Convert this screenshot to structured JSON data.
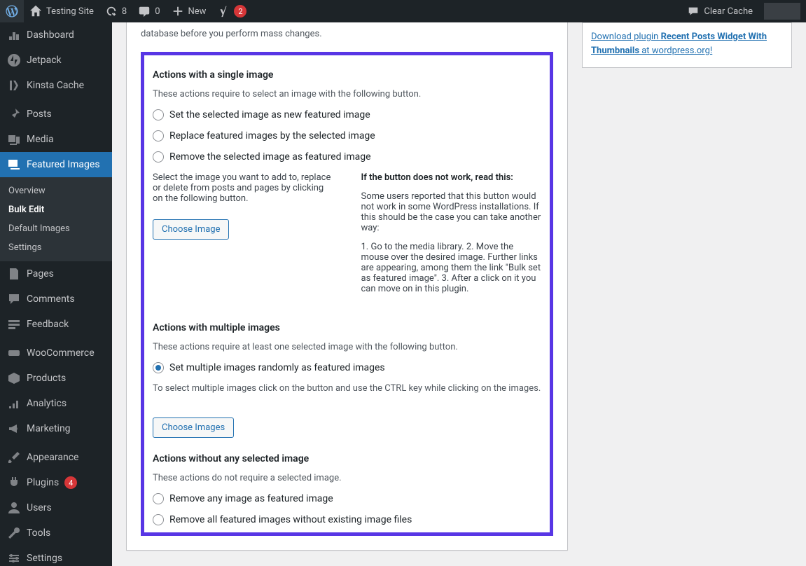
{
  "adminbar": {
    "site_name": "Testing Site",
    "updates_count": "8",
    "comments_count": "0",
    "new_label": "New",
    "yoast_count": "2",
    "clear_cache": "Clear Cache"
  },
  "sidebar": {
    "dashboard": "Dashboard",
    "jetpack": "Jetpack",
    "kinsta": "Kinsta Cache",
    "posts": "Posts",
    "media": "Media",
    "featured_images": "Featured Images",
    "sub": {
      "overview": "Overview",
      "bulk_edit": "Bulk Edit",
      "default_images": "Default Images",
      "settings": "Settings"
    },
    "pages": "Pages",
    "comments": "Comments",
    "feedback": "Feedback",
    "woocommerce": "WooCommerce",
    "products": "Products",
    "analytics": "Analytics",
    "marketing": "Marketing",
    "appearance": "Appearance",
    "plugins": "Plugins",
    "plugins_count": "4",
    "users": "Users",
    "tools": "Tools",
    "settings": "Settings"
  },
  "main": {
    "pre_text": "database before you perform mass changes.",
    "single": {
      "heading": "Actions with a single image",
      "desc": "These actions require to select an image with the following button.",
      "options": {
        "set": "Set the selected image as new featured image",
        "replace": "Replace featured images by the selected image",
        "remove": "Remove the selected image as featured image"
      },
      "left_help": "Select the image you want to add to, replace or delete from posts and pages by clicking on the following button.",
      "choose_btn": "Choose Image",
      "right_head": "If the button does not work, read this:",
      "right_p1": "Some users reported that this button would not work in some WordPress installations. If this should be the case you can take another way:",
      "right_p2": "1. Go to the media library. 2. Move the mouse over the desired image. Further links are appearing, among them the link \"Bulk set as featured image\". 3. After a click on it you can move on in this plugin."
    },
    "multiple": {
      "heading": "Actions with multiple images",
      "desc": "These actions require at least one selected image with the following button.",
      "option": "Set multiple images randomly as featured images",
      "help": "To select multiple images click on the button and use the CTRL key while clicking on the images.",
      "choose_btn": "Choose Images"
    },
    "none": {
      "heading": "Actions without any selected image",
      "desc": "These actions do not require a selected image.",
      "opt1": "Remove any image as featured image",
      "opt2": "Remove all featured images without existing image files"
    }
  },
  "widget": {
    "text_pre": "Download plugin ",
    "link_strong": "Recent Posts Widget With Thumbnails",
    "text_post": " at wordpress.org!"
  }
}
